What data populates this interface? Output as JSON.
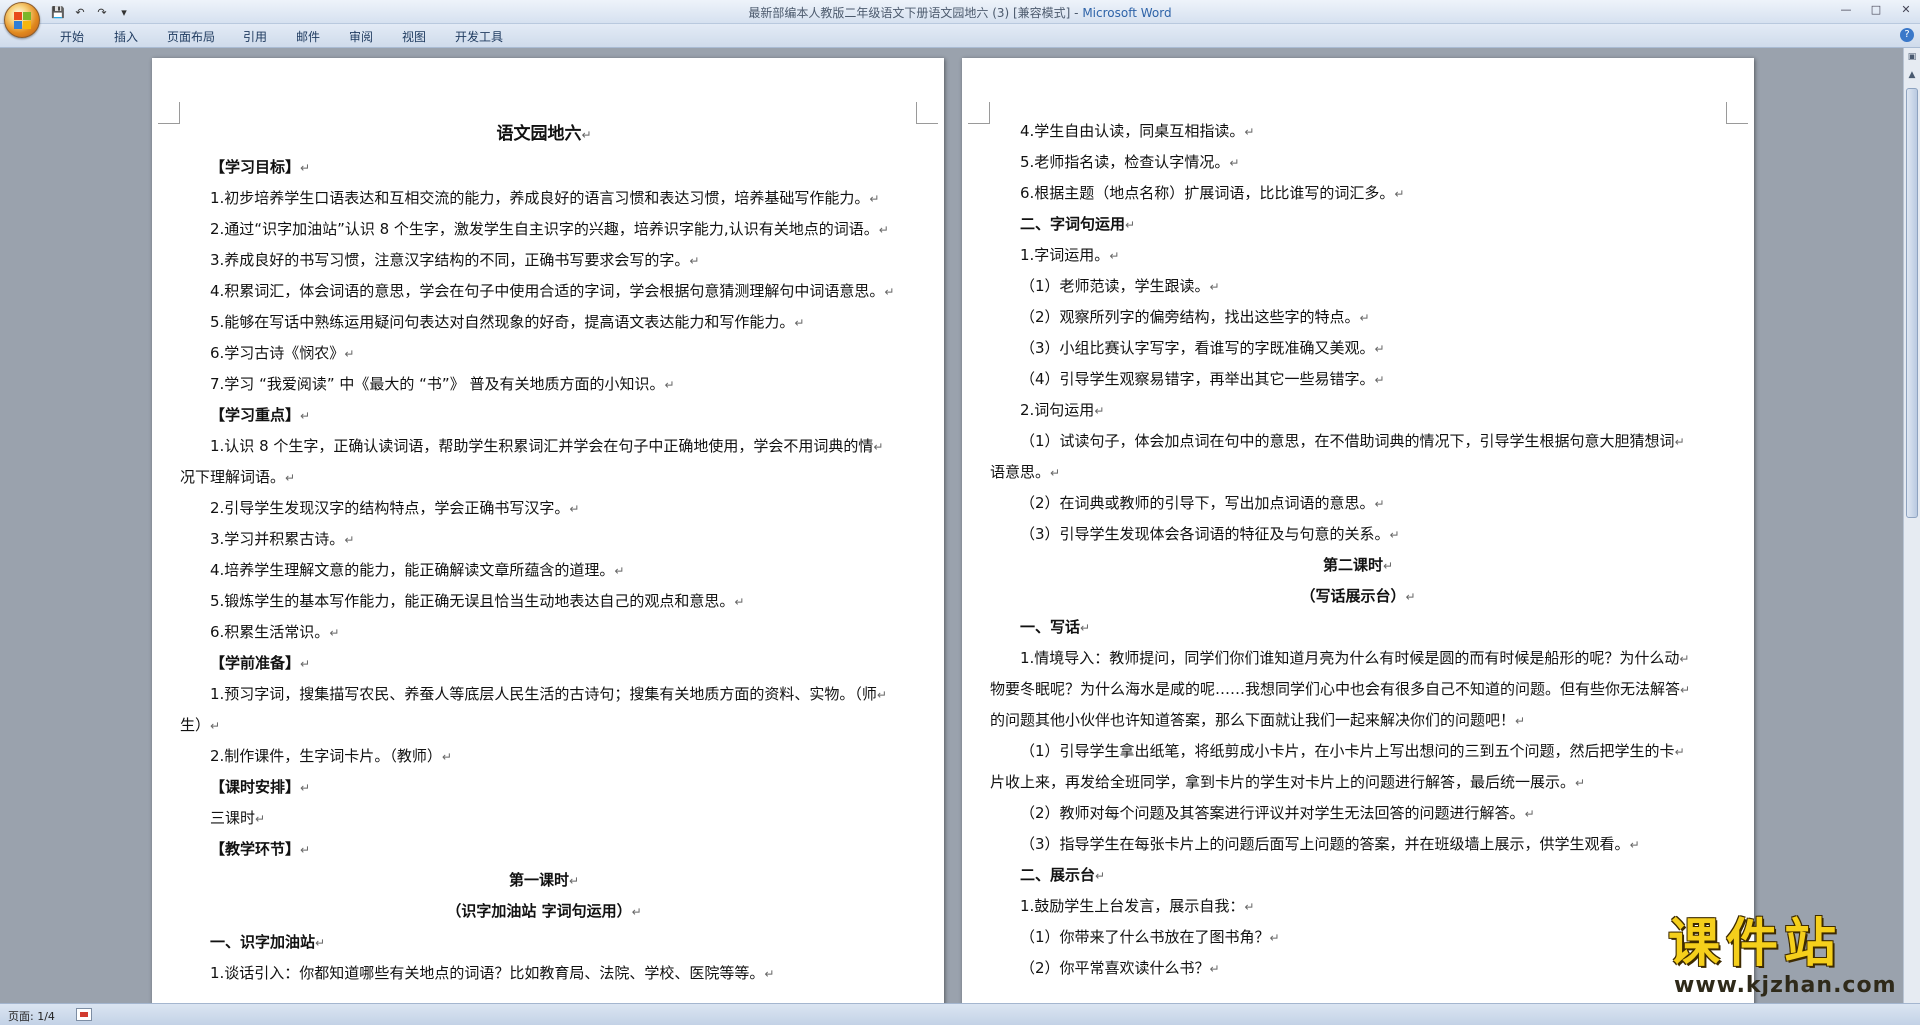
{
  "window": {
    "title": "最新部编本人教版二年级语文下册语文园地六 (3) [兼容模式] - ",
    "app_name": "Microsoft Word"
  },
  "qat": {
    "save_icon": "💾",
    "undo_icon": "↶",
    "redo_icon": "↷",
    "more_icon": "▾"
  },
  "ribbon_tabs": [
    "开始",
    "插入",
    "页面布局",
    "引用",
    "邮件",
    "审阅",
    "视图",
    "开发工具"
  ],
  "left_page": {
    "title": "语文园地六",
    "lines": [
      {
        "t": "【学习目标】",
        "cls": "bold ind"
      },
      {
        "t": "1.初步培养学生口语表达和互相交流的能力，养成良好的语言习惯和表达习惯，培养基础写作能力。",
        "cls": "ind"
      },
      {
        "t": "2.通过“识字加油站”认识 8 个生字，激发学生自主识字的兴趣，培养识字能力,认识有关地点的词语。",
        "cls": "ind"
      },
      {
        "t": "3.养成良好的书写习惯，注意汉字结构的不同，正确书写要求会写的字。",
        "cls": "ind"
      },
      {
        "t": "4.积累词汇，体会词语的意思，学会在句子中使用合适的字词，学会根据句意猜测理解句中词语意思。",
        "cls": "ind"
      },
      {
        "t": "5.能够在写话中熟练运用疑问句表达对自然现象的好奇，提高语文表达能力和写作能力。",
        "cls": "ind"
      },
      {
        "t": "6.学习古诗《悯农》",
        "cls": "ind"
      },
      {
        "t": "7.学习 “我爱阅读” 中《最大的 “书”》 普及有关地质方面的小知识。",
        "cls": "ind"
      },
      {
        "t": "【学习重点】",
        "cls": "bold ind"
      },
      {
        "t": "1.认识 8 个生字，正确认读词语，帮助学生积累词汇并学会在句子中正确地使用，学会不用词典的情",
        "cls": "ind"
      },
      {
        "t": "况下理解词语。",
        "cls": ""
      },
      {
        "t": "2.引导学生发现汉字的结构特点，学会正确书写汉字。",
        "cls": "ind"
      },
      {
        "t": "3.学习并积累古诗。",
        "cls": "ind"
      },
      {
        "t": "4.培养学生理解文意的能力，能正确解读文章所蕴含的道理。",
        "cls": "ind"
      },
      {
        "t": "5.锻炼学生的基本写作能力，能正确无误且恰当生动地表达自己的观点和意思。",
        "cls": "ind"
      },
      {
        "t": "6.积累生活常识。",
        "cls": "ind"
      },
      {
        "t": "【学前准备】",
        "cls": "bold ind"
      },
      {
        "t": "1.预习字词，搜集描写农民、养蚕人等底层人民生活的古诗句；搜集有关地质方面的资料、实物。（师",
        "cls": "ind"
      },
      {
        "t": "生）",
        "cls": ""
      },
      {
        "t": "2.制作课件，生字词卡片。（教师）",
        "cls": "ind"
      },
      {
        "t": "【课时安排】",
        "cls": "bold ind"
      },
      {
        "t": "三课时",
        "cls": "ind"
      },
      {
        "t": "【教学环节】",
        "cls": "bold ind"
      },
      {
        "t": "第一课时",
        "cls": "bold center"
      },
      {
        "t": "（识字加油站 字词句运用）",
        "cls": "bold center"
      },
      {
        "t": "一、识字加油站",
        "cls": "bold ind"
      },
      {
        "t": "1.谈话引入：你都知道哪些有关地点的词语？比如教育局、法院、学校、医院等等。",
        "cls": "ind"
      }
    ]
  },
  "right_page": {
    "lines": [
      {
        "t": "4.学生自由认读，同桌互相指读。",
        "cls": "ind"
      },
      {
        "t": "5.老师指名读，检查认字情况。",
        "cls": "ind"
      },
      {
        "t": "6.根据主题（地点名称）扩展词语，比比谁写的词汇多。",
        "cls": "ind"
      },
      {
        "t": "二、字词句运用",
        "cls": "bold ind"
      },
      {
        "t": "1.字词运用。",
        "cls": "ind"
      },
      {
        "t": "（1）老师范读，学生跟读。",
        "cls": "ind"
      },
      {
        "t": "（2）观察所列字的偏旁结构，找出这些字的特点。",
        "cls": "ind"
      },
      {
        "t": "（3）小组比赛认字写字，看谁写的字既准确又美观。",
        "cls": "ind"
      },
      {
        "t": "（4）引导学生观察易错字，再举出其它一些易错字。",
        "cls": "ind"
      },
      {
        "t": "2.词句运用",
        "cls": "ind"
      },
      {
        "t": "（1）试读句子，体会加点词在句中的意思，在不借助词典的情况下，引导学生根据句意大胆猜想词",
        "cls": "ind"
      },
      {
        "t": "语意思。",
        "cls": ""
      },
      {
        "t": "（2）在词典或教师的引导下，写出加点词语的意思。",
        "cls": "ind"
      },
      {
        "t": "（3）引导学生发现体会各词语的特征及与句意的关系。",
        "cls": "ind"
      },
      {
        "t": "第二课时",
        "cls": "bold center"
      },
      {
        "t": "（写话展示台）",
        "cls": "bold center"
      },
      {
        "t": "一、写话",
        "cls": "bold ind"
      },
      {
        "t": "1.情境导入：教师提问，同学们你们谁知道月亮为什么有时候是圆的而有时候是船形的呢？为什么动",
        "cls": "ind"
      },
      {
        "t": "物要冬眠呢？为什么海水是咸的呢……我想同学们心中也会有很多自己不知道的问题。但有些你无法解答",
        "cls": ""
      },
      {
        "t": "的问题其他小伙伴也许知道答案，那么下面就让我们一起来解决你们的问题吧！",
        "cls": ""
      },
      {
        "t": "（1）引导学生拿出纸笔，将纸剪成小卡片，在小卡片上写出想问的三到五个问题，然后把学生的卡",
        "cls": "ind"
      },
      {
        "t": "片收上来，再发给全班同学，拿到卡片的学生对卡片上的问题进行解答，最后统一展示。",
        "cls": ""
      },
      {
        "t": "（2）教师对每个问题及其答案进行评议并对学生无法回答的问题进行解答。",
        "cls": "ind"
      },
      {
        "t": "（3）指导学生在每张卡片上的问题后面写上问题的答案，并在班级墙上展示，供学生观看。",
        "cls": "ind"
      },
      {
        "t": "二、展示台",
        "cls": "bold ind"
      },
      {
        "t": "1.鼓励学生上台发言，展示自我：",
        "cls": "ind"
      },
      {
        "t": "（1）你带来了什么书放在了图书角？",
        "cls": "ind"
      },
      {
        "t": "（2）你平常喜欢读什么书？",
        "cls": "ind"
      }
    ]
  },
  "statusbar": {
    "page_info": "页面: 1/4"
  },
  "watermark": {
    "big": "课件站",
    "small": "www.kjzhan.com"
  },
  "colors": {
    "accent": "#2e63a8",
    "workspace": "#9aa2ad",
    "watermark": "#f5cf1b"
  }
}
